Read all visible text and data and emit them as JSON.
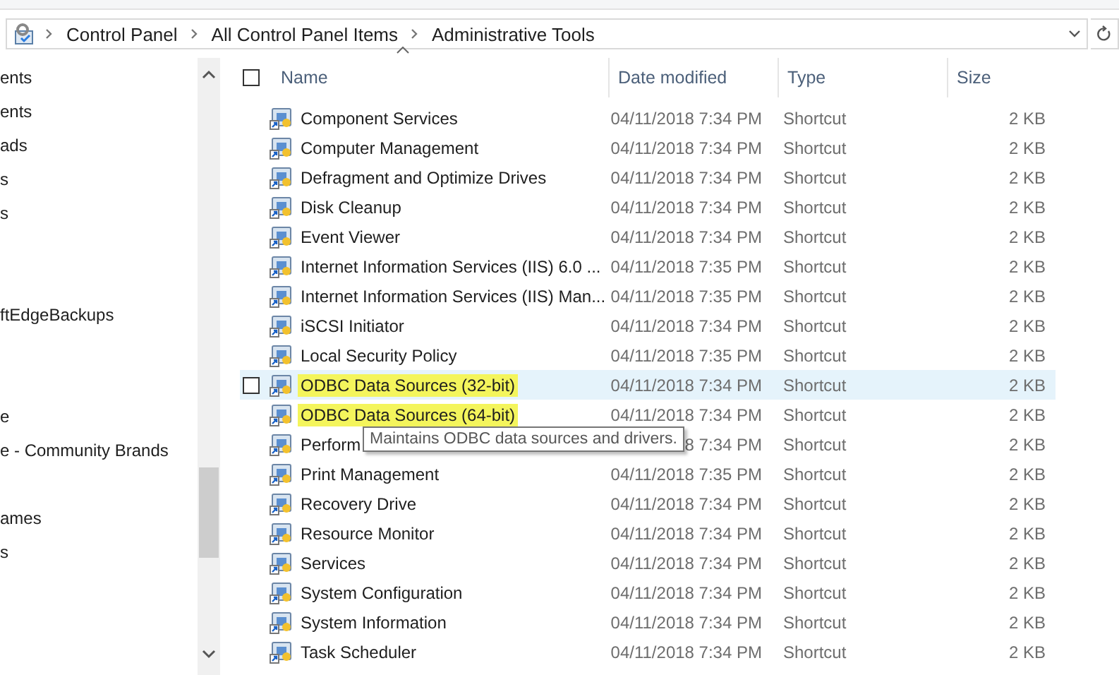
{
  "address_bar": {
    "breadcrumbs": [
      "Control Panel",
      "All Control Panel Items",
      "Administrative Tools"
    ]
  },
  "nav_pane": {
    "items": [
      "ents",
      "ents",
      "ads",
      "s",
      "s",
      "ftEdgeBackups",
      "e",
      "e - Community Brands",
      "ames",
      "s"
    ]
  },
  "file_list": {
    "select_all_checked": false,
    "columns": [
      "Name",
      "Date modified",
      "Type",
      "Size"
    ],
    "rows": [
      {
        "name": "Component Services",
        "date": "04/11/2018 7:34 PM",
        "type": "Shortcut",
        "size": "2 KB",
        "hovered": false,
        "highlighted": false
      },
      {
        "name": "Computer Management",
        "date": "04/11/2018 7:34 PM",
        "type": "Shortcut",
        "size": "2 KB",
        "hovered": false,
        "highlighted": false
      },
      {
        "name": "Defragment and Optimize Drives",
        "date": "04/11/2018 7:34 PM",
        "type": "Shortcut",
        "size": "2 KB",
        "hovered": false,
        "highlighted": false
      },
      {
        "name": "Disk Cleanup",
        "date": "04/11/2018 7:34 PM",
        "type": "Shortcut",
        "size": "2 KB",
        "hovered": false,
        "highlighted": false
      },
      {
        "name": "Event Viewer",
        "date": "04/11/2018 7:34 PM",
        "type": "Shortcut",
        "size": "2 KB",
        "hovered": false,
        "highlighted": false
      },
      {
        "name": "Internet Information Services (IIS) 6.0 ...",
        "date": "04/11/2018 7:35 PM",
        "type": "Shortcut",
        "size": "2 KB",
        "hovered": false,
        "highlighted": false
      },
      {
        "name": "Internet Information Services (IIS) Man...",
        "date": "04/11/2018 7:35 PM",
        "type": "Shortcut",
        "size": "2 KB",
        "hovered": false,
        "highlighted": false
      },
      {
        "name": "iSCSI Initiator",
        "date": "04/11/2018 7:34 PM",
        "type": "Shortcut",
        "size": "2 KB",
        "hovered": false,
        "highlighted": false
      },
      {
        "name": "Local Security Policy",
        "date": "04/11/2018 7:35 PM",
        "type": "Shortcut",
        "size": "2 KB",
        "hovered": false,
        "highlighted": false
      },
      {
        "name": "ODBC Data Sources (32-bit)",
        "date": "04/11/2018 7:34 PM",
        "type": "Shortcut",
        "size": "2 KB",
        "hovered": true,
        "highlighted": true
      },
      {
        "name": "ODBC Data Sources (64-bit)",
        "date": "04/11/2018 7:34 PM",
        "type": "Shortcut",
        "size": "2 KB",
        "hovered": false,
        "highlighted": true
      },
      {
        "name": "Perform",
        "date": "8 7:34 PM",
        "type": "Shortcut",
        "size": "2 KB",
        "hovered": false,
        "highlighted": false
      },
      {
        "name": "Print Management",
        "date": "04/11/2018 7:35 PM",
        "type": "Shortcut",
        "size": "2 KB",
        "hovered": false,
        "highlighted": false
      },
      {
        "name": "Recovery Drive",
        "date": "04/11/2018 7:34 PM",
        "type": "Shortcut",
        "size": "2 KB",
        "hovered": false,
        "highlighted": false
      },
      {
        "name": "Resource Monitor",
        "date": "04/11/2018 7:34 PM",
        "type": "Shortcut",
        "size": "2 KB",
        "hovered": false,
        "highlighted": false
      },
      {
        "name": "Services",
        "date": "04/11/2018 7:34 PM",
        "type": "Shortcut",
        "size": "2 KB",
        "hovered": false,
        "highlighted": false
      },
      {
        "name": "System Configuration",
        "date": "04/11/2018 7:34 PM",
        "type": "Shortcut",
        "size": "2 KB",
        "hovered": false,
        "highlighted": false
      },
      {
        "name": "System Information",
        "date": "04/11/2018 7:34 PM",
        "type": "Shortcut",
        "size": "2 KB",
        "hovered": false,
        "highlighted": false
      },
      {
        "name": "Task Scheduler",
        "date": "04/11/2018 7:34 PM",
        "type": "Shortcut",
        "size": "2 KB",
        "hovered": false,
        "highlighted": false
      }
    ]
  },
  "tooltip": {
    "text": "Maintains ODBC data sources and drivers."
  }
}
